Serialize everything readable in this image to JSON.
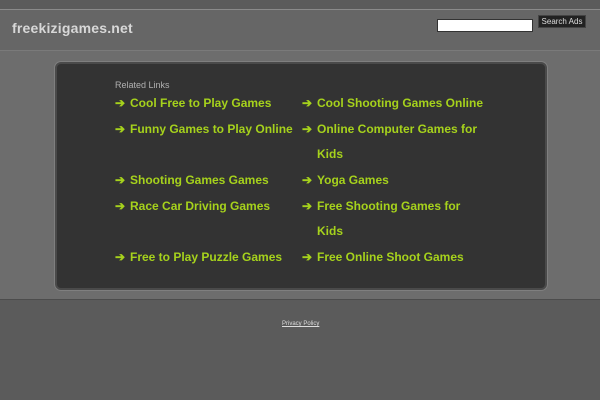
{
  "header": {
    "site_title": "freekizigames.net",
    "search_value": "",
    "search_button_label": "Search Ads"
  },
  "related": {
    "label": "Related Links",
    "arrow_glyph": "➔",
    "link_color": "#a6d21c",
    "left_column": [
      {
        "text": "Cool Free to Play Games"
      },
      {
        "text": "Funny Games to Play Online"
      },
      {
        "text": "Shooting Games Games"
      },
      {
        "text": "Race Car Driving Games"
      },
      {
        "text": "Free to Play Puzzle Games"
      }
    ],
    "right_column": [
      {
        "line1": "Cool Shooting Games Online",
        "line2": ""
      },
      {
        "line1": "Online Computer Games for",
        "line2": "Kids"
      },
      {
        "line1": "Yoga Games",
        "line2": ""
      },
      {
        "line1": "Free Shooting Games for",
        "line2": "Kids"
      },
      {
        "line1": "Free Online Shoot Games",
        "line2": ""
      }
    ]
  },
  "footer": {
    "privacy_label": "Privacy Policy"
  }
}
